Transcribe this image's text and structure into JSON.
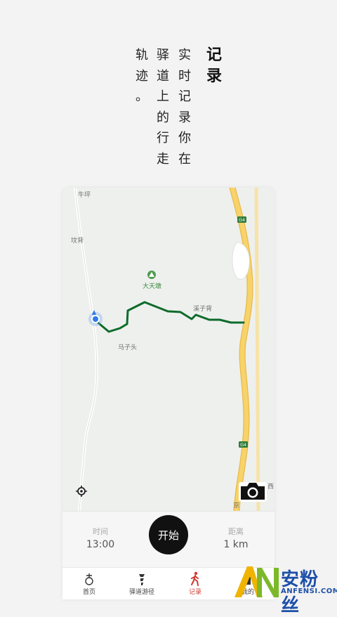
{
  "headline": {
    "col1": [
      "记",
      "录"
    ],
    "col2": [
      "实",
      "时",
      "记",
      "录",
      "你",
      "在"
    ],
    "col3": [
      "驿",
      "道",
      "上",
      "的",
      "行",
      "走"
    ],
    "col4": [
      "轨",
      "迹",
      "。"
    ]
  },
  "map": {
    "places": {
      "niuping": "牛坪",
      "wenbei": "坟背",
      "datiandun": "大天墩",
      "xiziebei": "溪子背",
      "mazitou": "马子头",
      "xi": "西",
      "jing": "京"
    },
    "highway_badges": [
      "G4",
      "G4"
    ],
    "colors": {
      "track": "#0e6b2a",
      "highway": "#f7d36a",
      "road": "#ffffff"
    }
  },
  "stats": {
    "time_label": "时间",
    "time_value": "13:00",
    "start_label": "开始",
    "distance_label": "距离",
    "distance_value": "1 km"
  },
  "tabs": [
    {
      "label": "首页",
      "icon": "home-icon"
    },
    {
      "label": "驿道游径",
      "icon": "route-icon"
    },
    {
      "label": "记录",
      "icon": "hiker-icon"
    },
    {
      "label": "我的",
      "icon": "profile-icon"
    }
  ],
  "watermark": {
    "text": "安粉丝",
    "sub": "ANFENSI.COM",
    "logo": "AN"
  }
}
